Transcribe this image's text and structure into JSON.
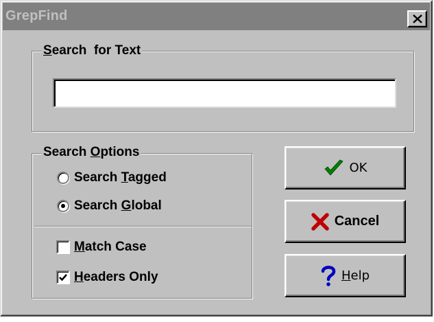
{
  "window": {
    "title": "GrepFind"
  },
  "search_text": {
    "legend_hotkey": "S",
    "legend_rest": "earch  for Text",
    "value": ""
  },
  "search_options": {
    "legend_prefix": "Search ",
    "legend_hotkey": "O",
    "legend_rest": "ptions",
    "radios": [
      {
        "prefix": "Search ",
        "hotkey": "T",
        "rest": "agged",
        "selected": false
      },
      {
        "prefix": "Search ",
        "hotkey": "G",
        "rest": "lobal",
        "selected": true
      }
    ],
    "checkboxes": [
      {
        "hotkey": "M",
        "rest": "atch Case",
        "checked": false
      },
      {
        "hotkey": "H",
        "rest": "eaders Only",
        "checked": true
      }
    ]
  },
  "buttons": {
    "ok": {
      "label": "OK",
      "icon": "checkmark-icon",
      "color": "#008000"
    },
    "cancel": {
      "label": "Cancel",
      "icon": "red-x-icon",
      "color": "#c00000"
    },
    "help": {
      "hotkey": "H",
      "rest": "elp",
      "icon": "question-mark-icon",
      "color": "#0000c0"
    }
  }
}
